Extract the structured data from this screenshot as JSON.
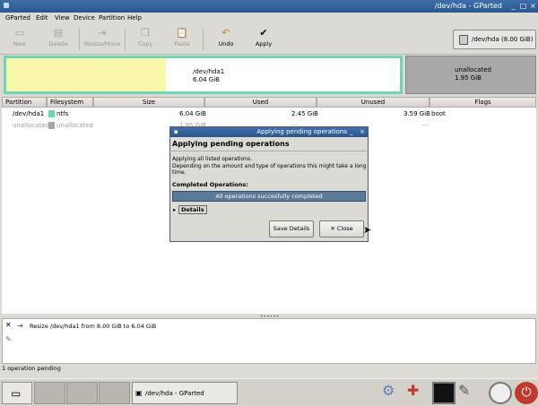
{
  "window": {
    "title": "/dev/hda - GParted"
  },
  "menu": [
    "GParted",
    "Edit",
    "View",
    "Device",
    "Partition",
    "Help"
  ],
  "toolbar": {
    "new": "New",
    "delete": "Delete",
    "resize": "Resize/Move",
    "copy": "Copy",
    "paste": "Paste",
    "undo": "Undo",
    "apply": "Apply"
  },
  "device": {
    "label": "/dev/hda",
    "size": "(8.00 GiB)"
  },
  "diskmap": {
    "p1_name": "/dev/hda1",
    "p1_size": "6.04 GiB",
    "un_name": "unallocated",
    "un_size": "1.95 GiB",
    "p1_used_fraction": 0.406
  },
  "columns": [
    "Partition",
    "Filesystem",
    "Size",
    "Used",
    "Unused",
    "Flags"
  ],
  "rows": [
    {
      "partition": "/dev/hda1",
      "filesystem": "ntfs",
      "size": "6.04 GiB",
      "used": "2.45 GiB",
      "unused": "3.59 GiB",
      "flags": "boot",
      "fs_color": "#6fd6b5"
    },
    {
      "partition": "unallocated",
      "filesystem": "unallocated",
      "size": "1.95 GiB",
      "used": "---",
      "unused": "---",
      "flags": "",
      "fs_color": "#a8a8a8"
    }
  ],
  "dialog": {
    "title": "Applying pending operations",
    "heading": "Applying pending operations",
    "line1": "Applying all listed operations.",
    "line2": "Depending on the amount and type of operations this might take a long time.",
    "completed_label": "Completed Operations:",
    "progress_text": "All operations succesfully completed",
    "progress_value": 1.0,
    "details": "Details",
    "save_details": "Save Details",
    "close": "Close"
  },
  "operations": [
    "Resize /dev/hda1 from 8.00 GiB to 6.04 GiB"
  ],
  "status": "1 operation pending",
  "taskbar": {
    "task": "/dev/hda - GParted"
  },
  "colors": {
    "titlebar": "#2a578f",
    "ntfs": "#6fd6b5",
    "used": "#f9f7a9",
    "unallocated": "#a8a8a8"
  }
}
